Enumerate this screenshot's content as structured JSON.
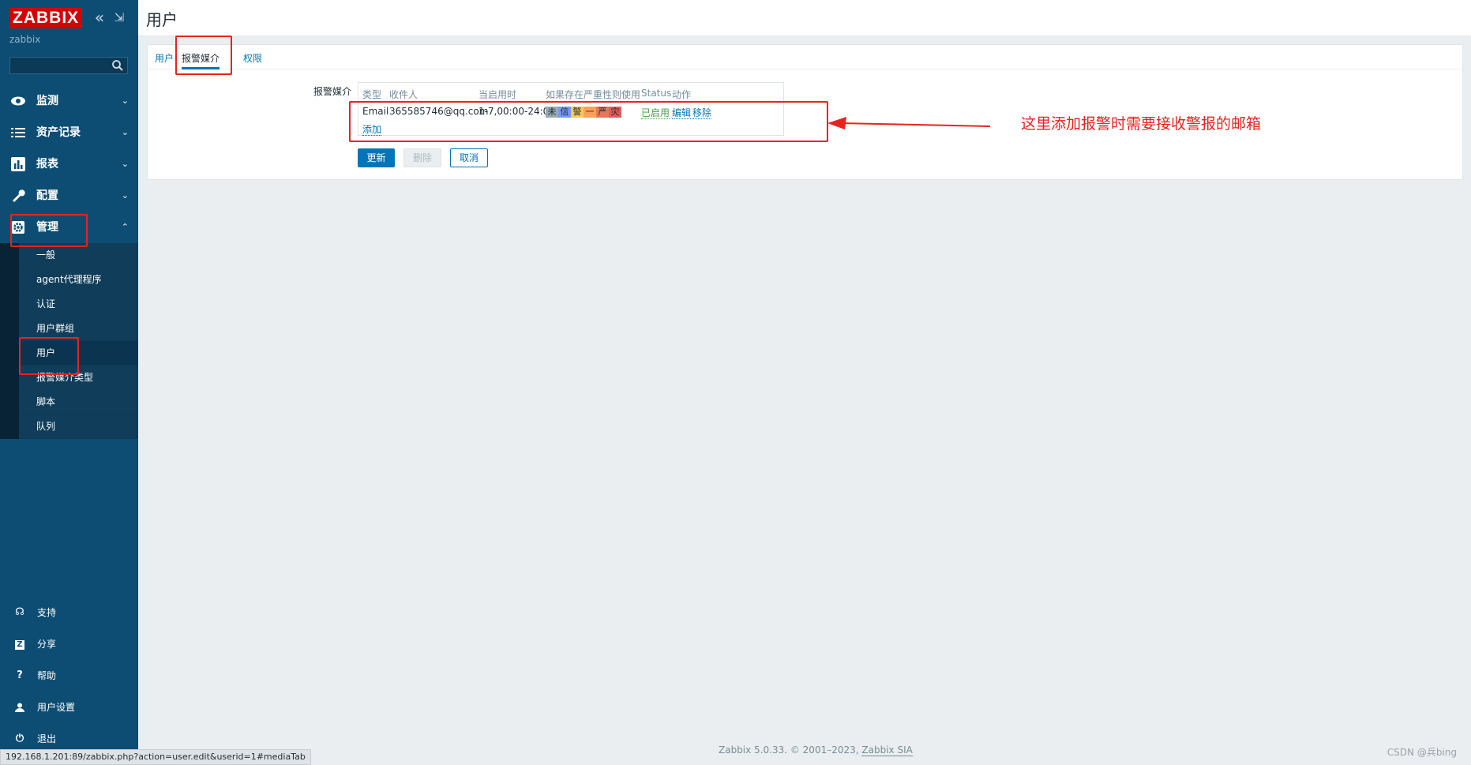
{
  "sidebar": {
    "logo": "ZABBIX",
    "server_name": "zabbix",
    "search_placeholder": "",
    "menu": [
      {
        "label": "监测",
        "icon": "eye-icon",
        "chevron": "⌄"
      },
      {
        "label": "资产记录",
        "icon": "list-icon",
        "chevron": "⌄"
      },
      {
        "label": "报表",
        "icon": "bar-chart-icon",
        "chevron": "⌄"
      },
      {
        "label": "配置",
        "icon": "wrench-icon",
        "chevron": "⌄"
      },
      {
        "label": "管理",
        "icon": "gear-icon",
        "chevron": "⌃"
      }
    ],
    "admin_submenu": [
      "一般",
      "agent代理程序",
      "认证",
      "用户群组",
      "用户",
      "报警媒介类型",
      "脚本",
      "队列"
    ],
    "bottom": [
      {
        "label": "支持",
        "icon": "headset-icon"
      },
      {
        "label": "分享",
        "icon": "share-icon"
      },
      {
        "label": "帮助",
        "icon": "help-icon"
      },
      {
        "label": "用户设置",
        "icon": "user-icon"
      },
      {
        "label": "退出",
        "icon": "power-icon"
      }
    ]
  },
  "header": {
    "title": "用户"
  },
  "tabs": [
    "用户",
    "报警媒介",
    "权限"
  ],
  "media": {
    "label": "报警媒介",
    "columns": [
      "类型",
      "收件人",
      "当启用时",
      "如果存在严重性则使用",
      "Status",
      "动作"
    ],
    "row": {
      "type": "Email",
      "recipient": "365585746@qq.com",
      "when_active": "1-7,00:00-24:00",
      "severities": [
        {
          "label": "未",
          "color": "#97aab3"
        },
        {
          "label": "信",
          "color": "#7499ff"
        },
        {
          "label": "警",
          "color": "#ffc859"
        },
        {
          "label": "一",
          "color": "#ffa059"
        },
        {
          "label": "严",
          "color": "#e97659"
        },
        {
          "label": "灾",
          "color": "#e45959"
        }
      ],
      "status": "已启用",
      "action_edit": "编辑",
      "action_remove": "移除"
    },
    "add_link": "添加"
  },
  "buttons": {
    "update": "更新",
    "delete": "删除",
    "cancel": "取消"
  },
  "annotation": {
    "note": "这里添加报警时需要接收警报的邮箱"
  },
  "footer": {
    "prefix": "Zabbix 5.0.33. © 2001–2023, ",
    "company": "Zabbix SIA"
  },
  "status_url": "192.168.1.201:89/zabbix.php?action=user.edit&userid=1#mediaTab",
  "watermark": "CSDN @兵bing",
  "colors": {
    "sidebar": "#0e4d73",
    "accent": "#0275b8",
    "annotation": "#e8231f",
    "logo": "#d40000"
  }
}
